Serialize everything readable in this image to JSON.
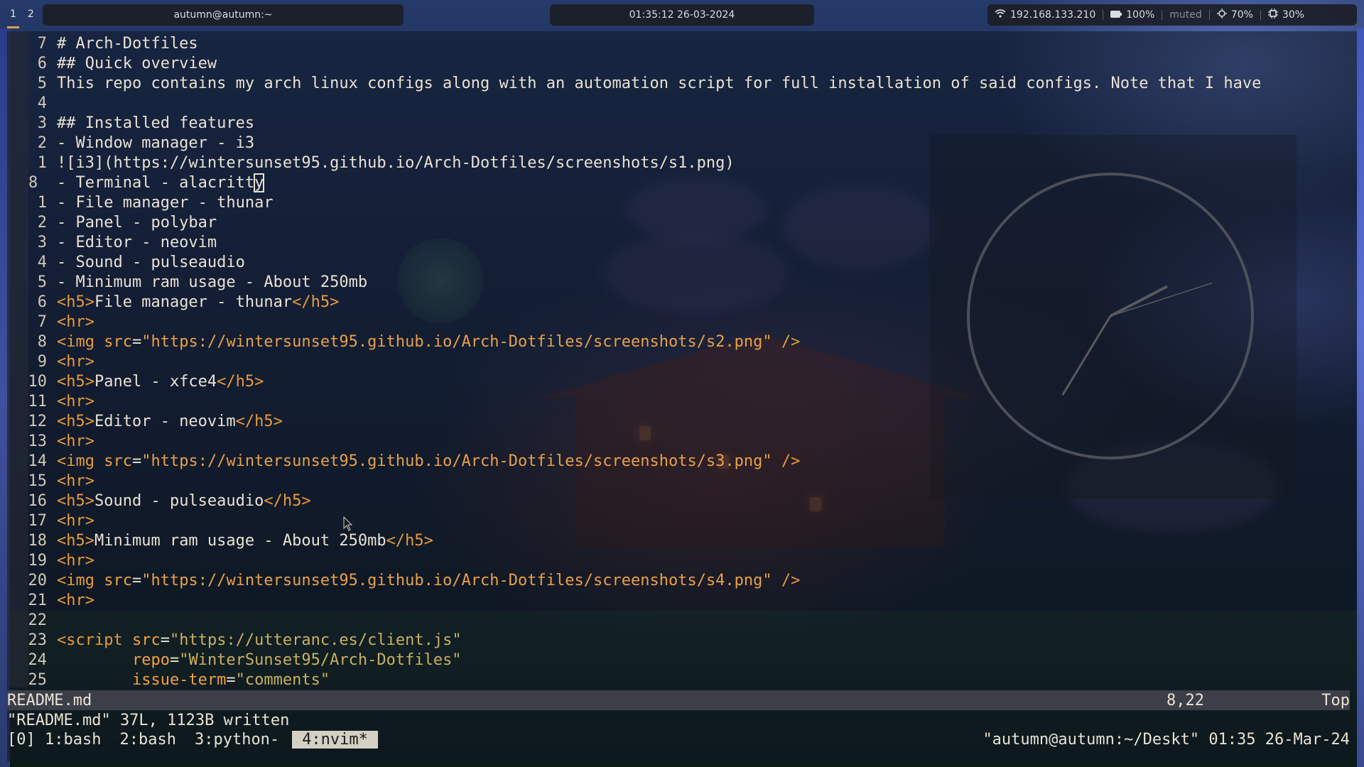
{
  "topbar": {
    "workspaces": [
      "1",
      "2"
    ],
    "window_title": "autumn@autumn:~",
    "clock": "01:35:12 26-03-2024",
    "status": {
      "ip": "192.168.133.210",
      "battery": "100%",
      "volume": "muted",
      "brightness": "70%",
      "cpu": "30%"
    },
    "icons": [
      "wifi-icon",
      "battery-icon",
      "brightness-icon",
      "cpu-icon"
    ]
  },
  "editor": {
    "lines": [
      {
        "num": "7",
        "text": "# Arch-Dotfiles"
      },
      {
        "num": "6",
        "text": "## Quick overview"
      },
      {
        "num": "5",
        "text": "This repo contains my arch linux configs along with an automation script for full installation of said configs. Note that I have"
      },
      {
        "num": "4",
        "text": ""
      },
      {
        "num": "3",
        "text": "## Installed features"
      },
      {
        "num": "2",
        "text": "- Window manager - i3"
      },
      {
        "num": "1",
        "text": "![i3](https://wintersunset95.github.io/Arch-Dotfiles/screenshots/s1.png)"
      },
      {
        "num": "8",
        "text_before": "- Terminal - alacritt",
        "cursor_char": "y",
        "current": true
      },
      {
        "num": "1",
        "text": "- File manager - thunar"
      },
      {
        "num": "2",
        "text": "- Panel - polybar"
      },
      {
        "num": "3",
        "text": "- Editor - neovim"
      },
      {
        "num": "4",
        "text": "- Sound - pulseaudio"
      },
      {
        "num": "5",
        "text": "- Minimum ram usage - About 250mb"
      },
      {
        "num": "6",
        "parts": [
          {
            "t": "<h5>",
            "c": "tag"
          },
          {
            "t": "File manager - thunar",
            "c": "txt"
          },
          {
            "t": "</h5>",
            "c": "tag"
          }
        ]
      },
      {
        "num": "7",
        "parts": [
          {
            "t": "<hr>",
            "c": "tag"
          }
        ]
      },
      {
        "num": "8",
        "parts": [
          {
            "t": "<img ",
            "c": "tag"
          },
          {
            "t": "src",
            "c": "attr"
          },
          {
            "t": "=",
            "c": "txt"
          },
          {
            "t": "\"https://wintersunset95.github.io/Arch-Dotfiles/screenshots/s2.png\"",
            "c": "str"
          },
          {
            "t": " />",
            "c": "tag"
          }
        ]
      },
      {
        "num": "9",
        "parts": [
          {
            "t": "<hr>",
            "c": "tag"
          }
        ]
      },
      {
        "num": "10",
        "parts": [
          {
            "t": "<h5>",
            "c": "tag"
          },
          {
            "t": "Panel - xfce4",
            "c": "txt"
          },
          {
            "t": "</h5>",
            "c": "tag"
          }
        ]
      },
      {
        "num": "11",
        "parts": [
          {
            "t": "<hr>",
            "c": "tag"
          }
        ]
      },
      {
        "num": "12",
        "parts": [
          {
            "t": "<h5>",
            "c": "tag"
          },
          {
            "t": "Editor - neovim",
            "c": "txt"
          },
          {
            "t": "</h5>",
            "c": "tag"
          }
        ]
      },
      {
        "num": "13",
        "parts": [
          {
            "t": "<hr>",
            "c": "tag"
          }
        ]
      },
      {
        "num": "14",
        "parts": [
          {
            "t": "<img ",
            "c": "tag"
          },
          {
            "t": "src",
            "c": "attr"
          },
          {
            "t": "=",
            "c": "txt"
          },
          {
            "t": "\"https://wintersunset95.github.io/Arch-Dotfiles/screenshots/s3.png\"",
            "c": "str"
          },
          {
            "t": " />",
            "c": "tag"
          }
        ]
      },
      {
        "num": "15",
        "parts": [
          {
            "t": "<hr>",
            "c": "tag"
          }
        ]
      },
      {
        "num": "16",
        "parts": [
          {
            "t": "<h5>",
            "c": "tag"
          },
          {
            "t": "Sound - pulseaudio",
            "c": "txt"
          },
          {
            "t": "</h5>",
            "c": "tag"
          }
        ]
      },
      {
        "num": "17",
        "parts": [
          {
            "t": "<hr>",
            "c": "tag"
          }
        ]
      },
      {
        "num": "18",
        "parts": [
          {
            "t": "<h5>",
            "c": "tag"
          },
          {
            "t": "Minimum ram usage - About 250mb",
            "c": "txt"
          },
          {
            "t": "</h5>",
            "c": "tag"
          }
        ]
      },
      {
        "num": "19",
        "parts": [
          {
            "t": "<hr>",
            "c": "tag"
          }
        ]
      },
      {
        "num": "20",
        "parts": [
          {
            "t": "<img ",
            "c": "tag"
          },
          {
            "t": "src",
            "c": "attr"
          },
          {
            "t": "=",
            "c": "txt"
          },
          {
            "t": "\"https://wintersunset95.github.io/Arch-Dotfiles/screenshots/s4.png\"",
            "c": "str"
          },
          {
            "t": " />",
            "c": "tag"
          }
        ]
      },
      {
        "num": "21",
        "parts": [
          {
            "t": "<hr>",
            "c": "tag"
          }
        ]
      },
      {
        "num": "22",
        "text": ""
      },
      {
        "num": "23",
        "parts": [
          {
            "t": "<script ",
            "c": "tag"
          },
          {
            "t": "src",
            "c": "attr"
          },
          {
            "t": "=",
            "c": "txt"
          },
          {
            "t": "\"https://utteranc.es/client.js\"",
            "c": "strg"
          }
        ]
      },
      {
        "num": "24",
        "parts": [
          {
            "t": "        repo",
            "c": "attr"
          },
          {
            "t": "=",
            "c": "txt"
          },
          {
            "t": "\"WinterSunset95/Arch-Dotfiles\"",
            "c": "strg"
          }
        ]
      },
      {
        "num": "25",
        "parts": [
          {
            "t": "        issue-term",
            "c": "attr"
          },
          {
            "t": "=",
            "c": "txt"
          },
          {
            "t": "\"comments\"",
            "c": "strg"
          }
        ]
      }
    ]
  },
  "statusline": {
    "filename": "README.md",
    "position": "8,22",
    "scroll": "Top"
  },
  "message": "\"README.md\" 37L, 1123B written",
  "tmux": {
    "session": "[0]",
    "windows": [
      "1:bash",
      "2:bash",
      "3:python-",
      "4:nvim*"
    ],
    "active_window": "4:nvim*",
    "right": "\"autumn@autumn:~/Deskt\" 01:35 26-Mar-24"
  },
  "clock_widget": {
    "hour": 1,
    "minute": 35,
    "second": 12
  },
  "colors": {
    "tag": "#e89a3c",
    "string": "#e8a04a",
    "text": "#e8e2d4",
    "accent": "#d8a250",
    "statusline_bg": "#3c3f48"
  }
}
